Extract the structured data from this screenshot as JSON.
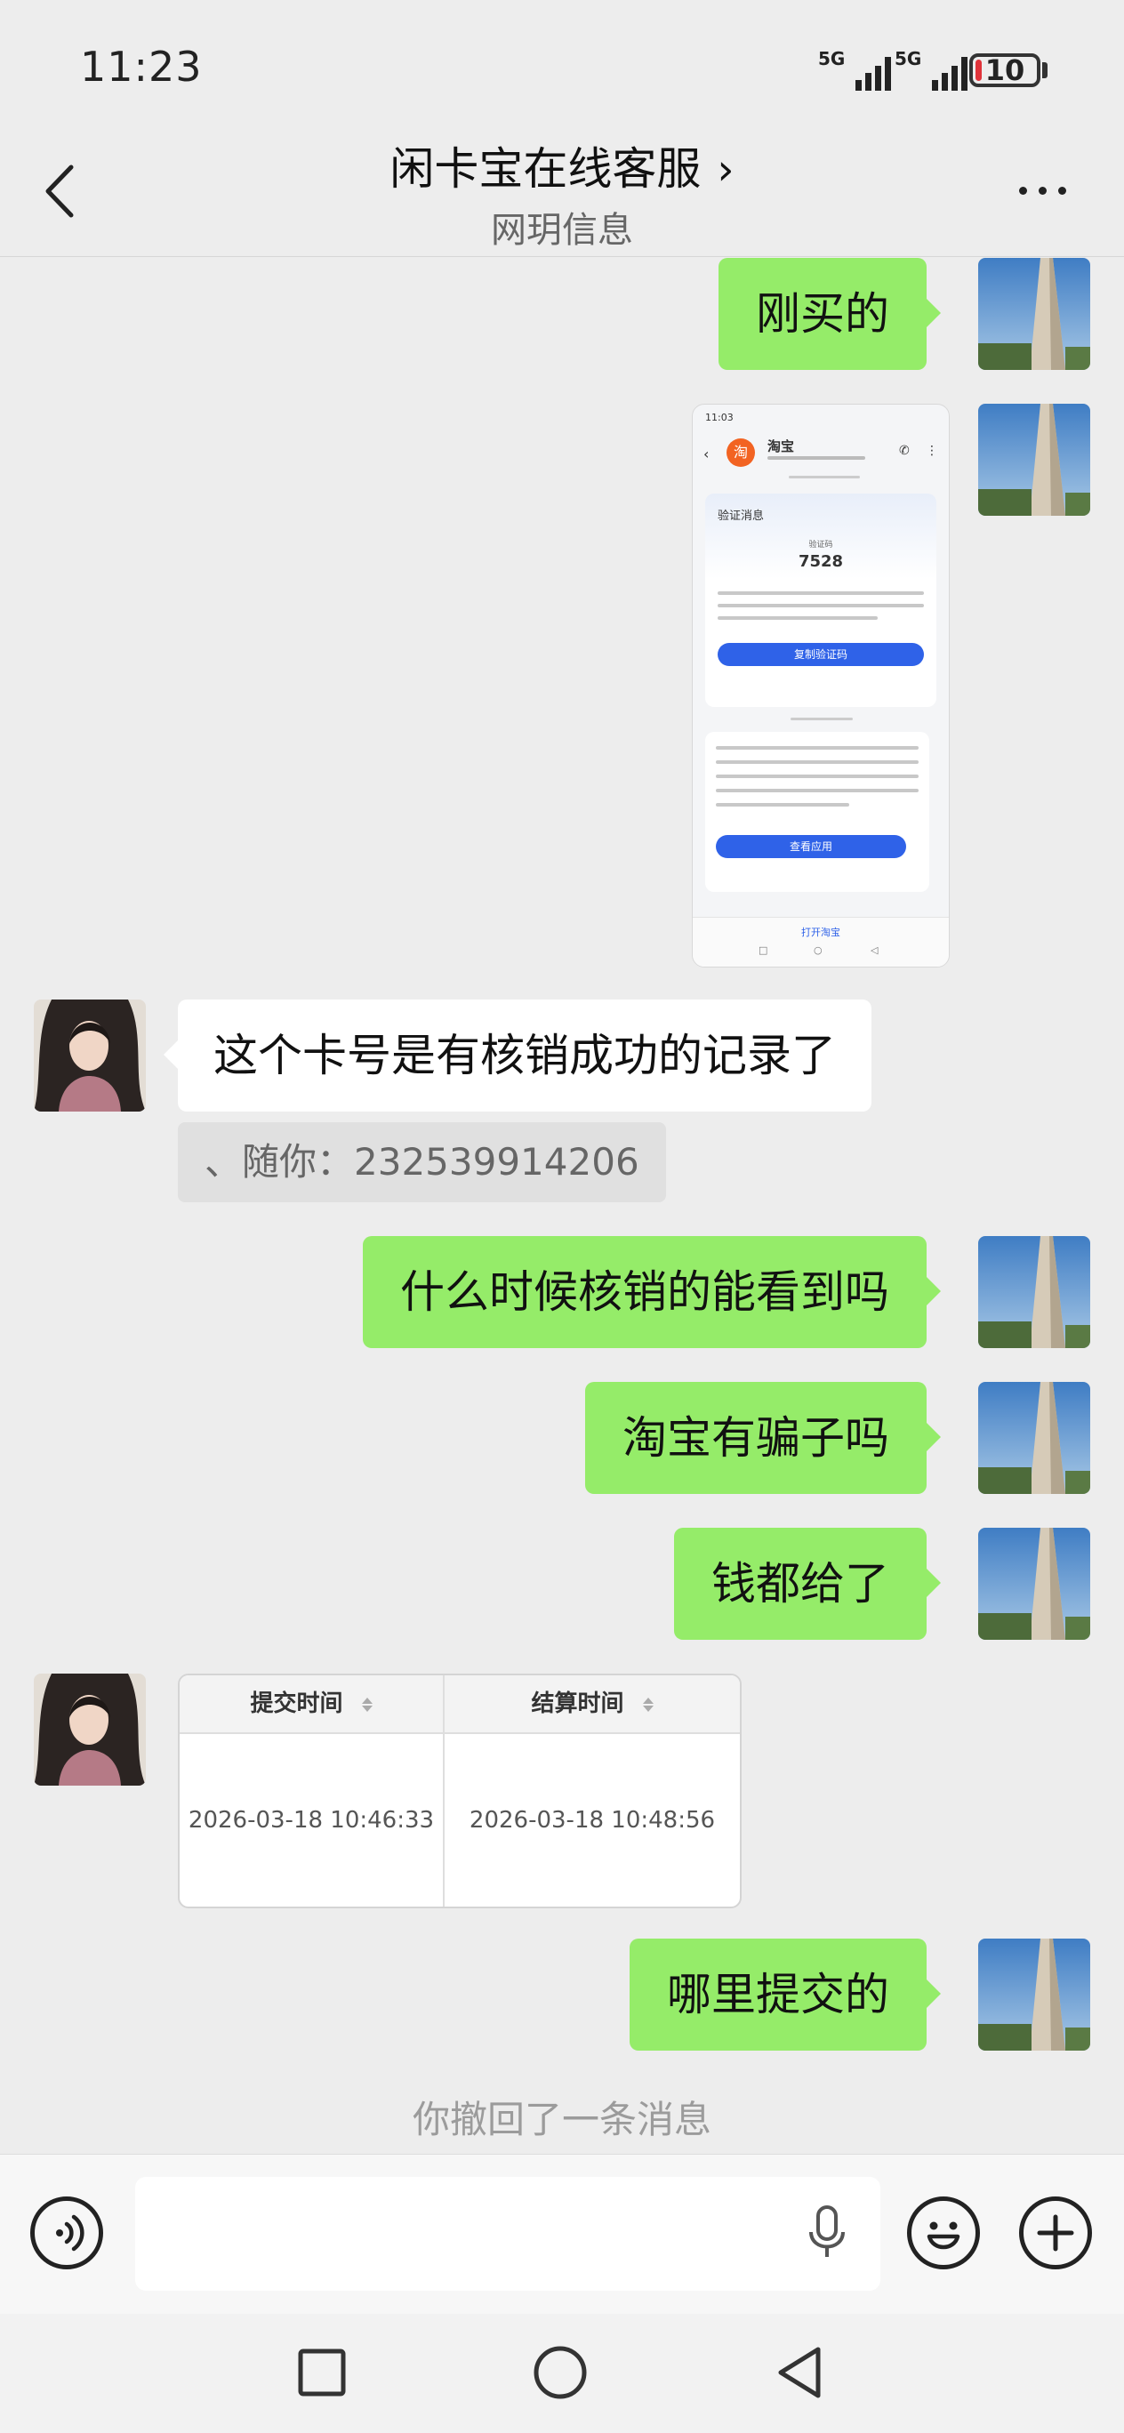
{
  "status_bar": {
    "time": "11:23",
    "signal1_label": "5G",
    "signal2_label": "5G",
    "battery": "10",
    "battery_level": 0.1
  },
  "header": {
    "title": "闲卡宝在线客服",
    "title_chevron": "›",
    "subtitle": "网玥信息",
    "back_icon": "chevron-left-icon",
    "more_icon": "more-dots-icon"
  },
  "messages": [
    {
      "from": "self",
      "type": "text",
      "text": "刚买的"
    },
    {
      "from": "self",
      "type": "image",
      "image": {
        "time": "11:03",
        "app": "淘宝",
        "app_icon": "淘",
        "card_title": "验证消息",
        "code_label": "验证码",
        "code": "7528",
        "copy_button": "复制验证码",
        "view_button": "查看应用",
        "open_label": "打开淘宝"
      }
    },
    {
      "from": "other",
      "type": "text",
      "text": "这个卡号是有核销成功的记录了"
    },
    {
      "from": "other",
      "type": "quote",
      "text": "、随你：232539914206"
    },
    {
      "from": "self",
      "type": "text",
      "text": "什么时候核销的能看到吗"
    },
    {
      "from": "self",
      "type": "text",
      "text": "淘宝有骗子吗"
    },
    {
      "from": "self",
      "type": "text",
      "text": "钱都给了"
    },
    {
      "from": "other",
      "type": "table_image",
      "table": {
        "headers": [
          "提交时间",
          "结算时间"
        ],
        "row": [
          "2026-03-18 10:46:33",
          "2026-03-18 10:48:56"
        ]
      }
    },
    {
      "from": "self",
      "type": "text",
      "text": "哪里提交的"
    }
  ],
  "recall_notice": "你撤回了一条消息",
  "input_bar": {
    "voice_icon": "voice-mode-icon",
    "mic_icon": "microphone-icon",
    "emoji_icon": "emoji-icon",
    "plus_icon": "plus-icon",
    "value": ""
  },
  "system_nav": [
    "recent-apps-icon",
    "home-icon",
    "back-triangle-icon"
  ],
  "colors": {
    "bubble_self": "#95ec69",
    "bubble_other": "#ffffff",
    "background": "#ededed"
  }
}
